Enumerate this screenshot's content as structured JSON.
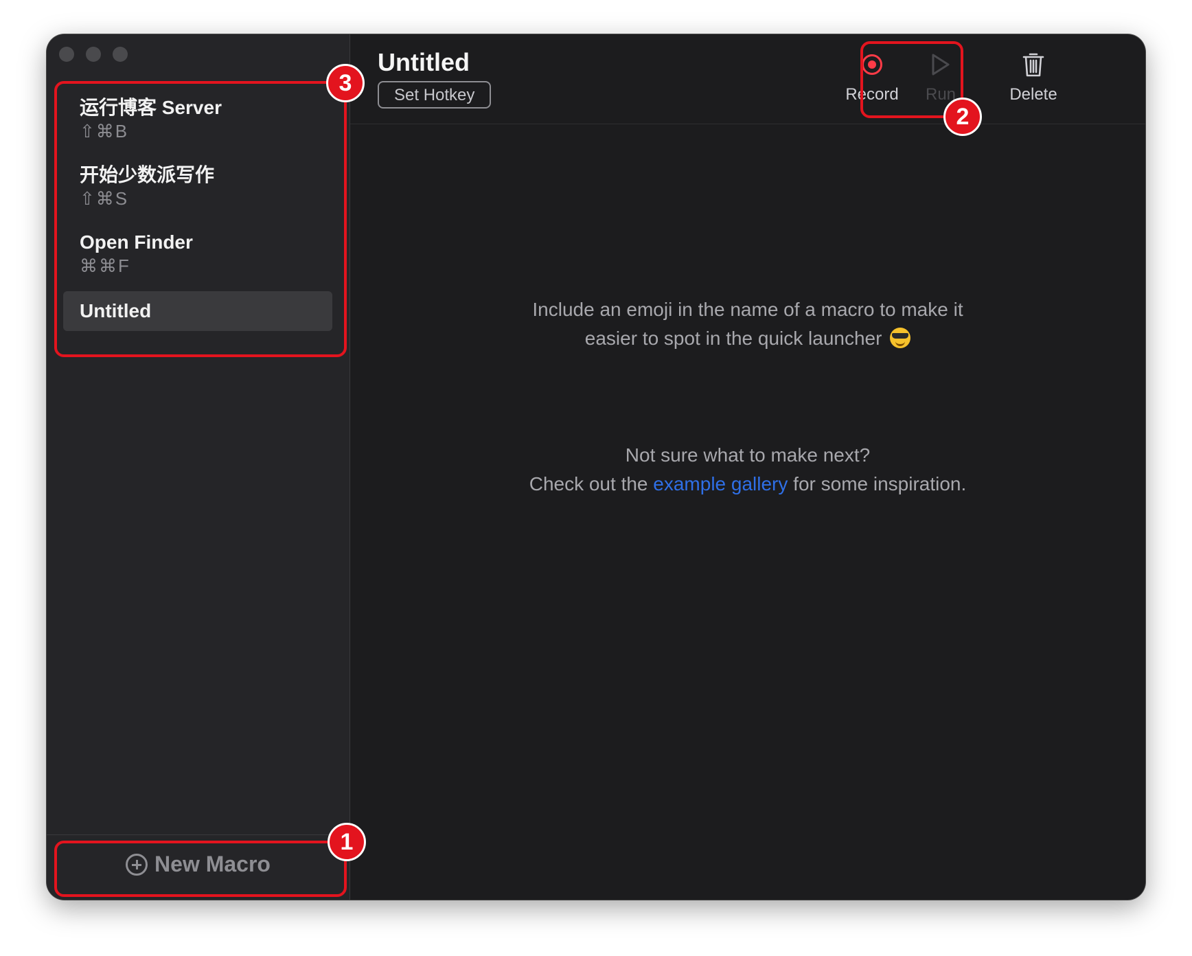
{
  "sidebar": {
    "macros": [
      {
        "name": "运行博客 Server",
        "hotkey": "⇧⌘B"
      },
      {
        "name": "开始少数派写作",
        "hotkey": "⇧⌘S"
      },
      {
        "name": "Open Finder",
        "hotkey": "⌘⌘F"
      }
    ],
    "selected": {
      "name": "Untitled"
    },
    "new_macro_label": "New Macro"
  },
  "header": {
    "title": "Untitled",
    "set_hotkey_label": "Set Hotkey"
  },
  "toolbar": {
    "record_label": "Record",
    "run_label": "Run",
    "delete_label": "Delete"
  },
  "main": {
    "tip_line1": "Include an emoji in the name of a macro to make it",
    "tip_line2": "easier to spot in the quick launcher",
    "next_line1": "Not sure what to make next?",
    "next_prefix": "Check out the",
    "gallery_link": "example gallery",
    "next_suffix": "for some inspiration."
  },
  "annotations": {
    "badge_1": "1",
    "badge_2": "2",
    "badge_3": "3"
  },
  "colors": {
    "accent_record": "#ff3b47",
    "link": "#2f6fe6",
    "annotation": "#e3141e"
  }
}
